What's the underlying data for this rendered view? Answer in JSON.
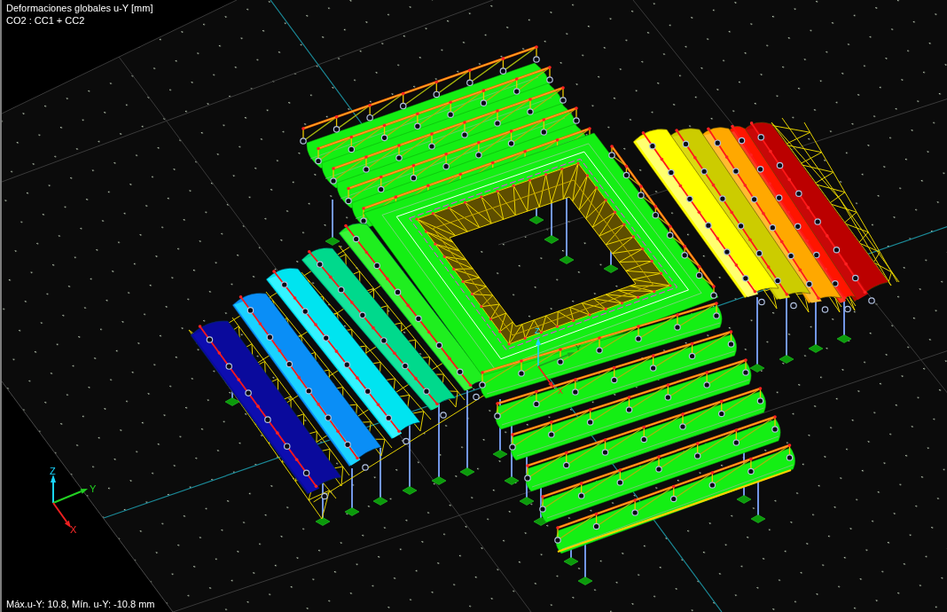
{
  "viewport": {
    "title": "Deformaciones globales u-Y [mm]",
    "load_combination": "CO2 : CC1 + CC2",
    "axes": [
      {
        "label": "Z"
      },
      {
        "label": "Y"
      },
      {
        "label": "X"
      }
    ],
    "origin_axes": [
      {
        "label": "Z"
      },
      {
        "label": "Y"
      },
      {
        "label": "X"
      }
    ],
    "status": "Máx.u-Y: 10.8, Mín. u-Y: -10.8 mm"
  }
}
